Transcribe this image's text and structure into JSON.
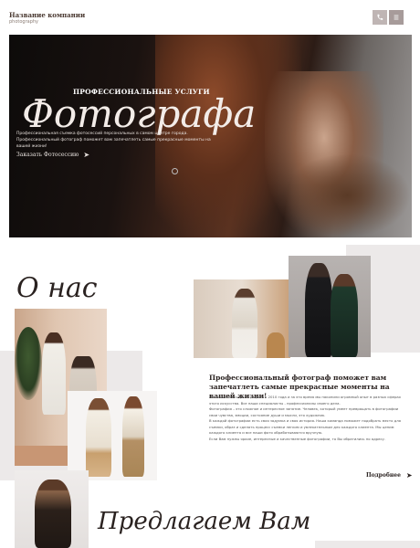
{
  "header": {
    "company_name": "Название компании",
    "company_tagline": "photography",
    "phone_icon": "phone-icon",
    "menu_icon": "menu-icon"
  },
  "hero": {
    "subtitle": "ПРОФЕССИОНАЛЬНЫЕ УСЛУГИ",
    "title": "Фотографа",
    "description": "Профессиональная съемка фотосессий персональных в самом центре города. Профессиональный фотограф поможет вам запечатлеть самые прекрасные моменты на вашей жизни!",
    "cta_label": "Заказать Фотосессию",
    "cta_icon": "arrow-right-icon"
  },
  "about": {
    "title": "О нас",
    "heading": "Профессиональный фотограф поможет вам запечатлеть самые прекрасные моменты на вашей жизни!",
    "paragraphs": [
      "Мы занимаемся фотографией с 2010 года и за это время мы накопили огромный опыт в разных сферах этого искусства. Все наши специалисты - профессионалы своего дела.",
      "Фотография – это сложное и интересное занятие. Человек, который умеет превращать в фотографии свои чувства, эмоции, состояние души и мысли, это художник.",
      "В каждой фотографии есть своя задумка и своя история. Наша команда поможет подобрать место для съемки, образ и сделать процесс съемки легким и увлекательным для каждого клиента. Мы ценим каждого клиента и все наши фото обрабатываются вручную.",
      "Если Вам нужны яркие, интересные и качественные фотографии, то Вы обратились по адресу."
    ],
    "more_label": "Подробнее",
    "more_icon": "arrow-right-icon"
  },
  "offer": {
    "title": "Предлагаем Вам"
  },
  "colors": {
    "accent_gray": "#bfb5b4",
    "block_gray": "#ece9e9",
    "text_dark": "#2a2220"
  }
}
